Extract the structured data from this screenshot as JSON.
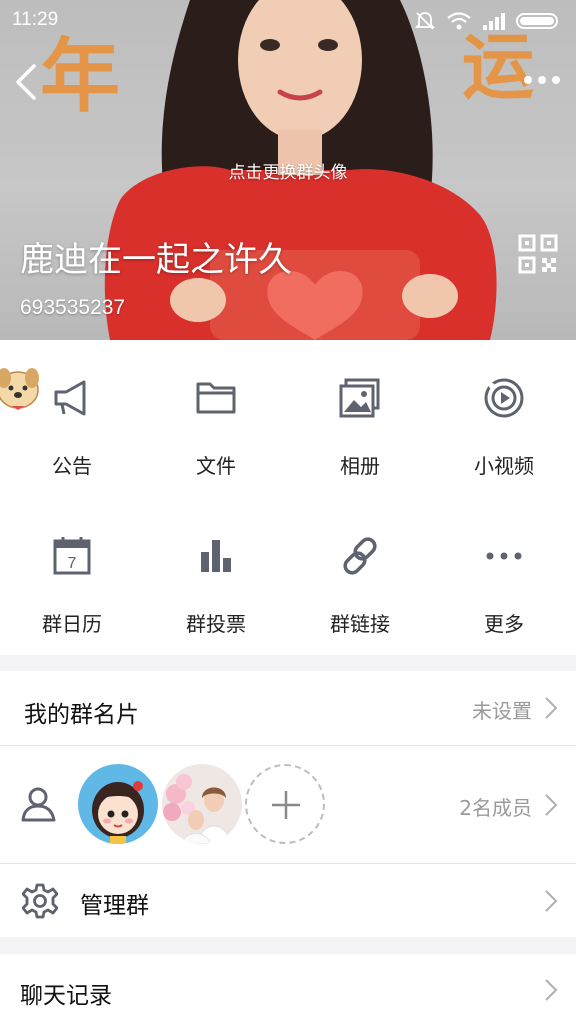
{
  "status_bar": {
    "time": "11:29"
  },
  "header": {
    "change_avatar_hint": "点击更换群头像",
    "group_name": "鹿迪在一起之许久",
    "group_id": "693535237",
    "cover_text_left": "年",
    "cover_text_right": "运"
  },
  "features": {
    "items": [
      {
        "label": "公告",
        "icon": "megaphone-icon"
      },
      {
        "label": "文件",
        "icon": "folder-icon"
      },
      {
        "label": "相册",
        "icon": "photo-album-icon"
      },
      {
        "label": "小视频",
        "icon": "short-video-icon"
      },
      {
        "label": "群日历",
        "icon": "calendar-icon"
      },
      {
        "label": "群投票",
        "icon": "vote-chart-icon"
      },
      {
        "label": "群链接",
        "icon": "link-icon"
      },
      {
        "label": "更多",
        "icon": "more-dots-icon"
      }
    ],
    "calendar_day": "7"
  },
  "my_card": {
    "title": "我的群名片",
    "value": "未设置"
  },
  "members": {
    "count_text": "2名成员"
  },
  "manage": {
    "title": "管理群"
  },
  "chat_history": {
    "title": "聊天记录"
  },
  "colors": {
    "icon_gray": "#5f6370",
    "accent_orange": "#e8913a",
    "dress_red": "#d9302c"
  }
}
